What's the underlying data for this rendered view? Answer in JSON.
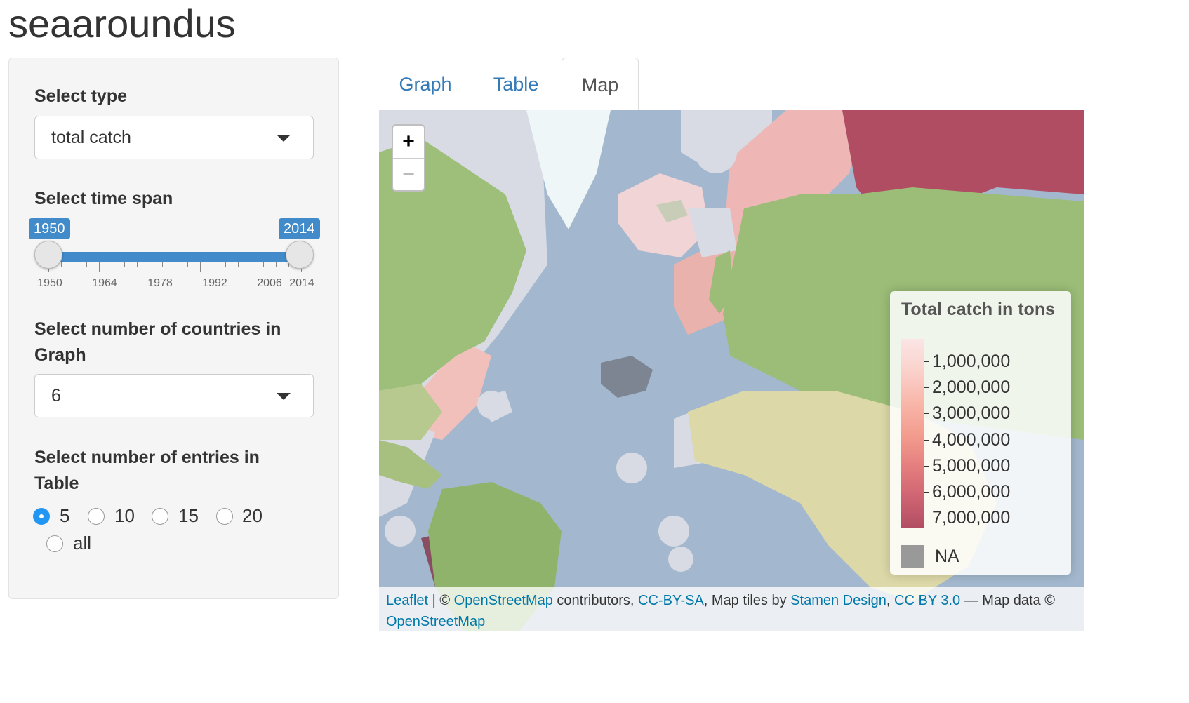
{
  "app": {
    "title": "seaaroundus"
  },
  "sidebar": {
    "type_label": "Select type",
    "type_value": "total catch",
    "timespan_label": "Select time span",
    "timespan": {
      "min": 1950,
      "max": 2014,
      "from_label": "1950",
      "to_label": "2014",
      "from_value": 1950,
      "to_value": 2014,
      "ticks": [
        "1950",
        "1964",
        "1978",
        "1992",
        "2006",
        "2014"
      ]
    },
    "countries_label": "Select number of countries in Graph",
    "countries_label_line1": "Select number of countries in",
    "countries_label_line2": "Graph",
    "countries_value": "6",
    "entries_label_line1": "Select number of entries in",
    "entries_label_line2": "Table",
    "entries_options": [
      "5",
      "10",
      "15",
      "20",
      "all"
    ],
    "entries_selected": "5"
  },
  "tabs": [
    {
      "label": "Graph",
      "active": false
    },
    {
      "label": "Table",
      "active": false
    },
    {
      "label": "Map",
      "active": true
    }
  ],
  "map": {
    "zoom_in": "+",
    "zoom_out": "−",
    "legend": {
      "title": "Total catch in tons",
      "values": [
        "1,000,000",
        "2,000,000",
        "3,000,000",
        "4,000,000",
        "5,000,000",
        "6,000,000",
        "7,000,000"
      ],
      "na_label": "NA",
      "colors": {
        "low": "#fbe5e5",
        "high": "#b14d63",
        "na": "#999999"
      }
    },
    "attribution": {
      "leaflet": "Leaflet",
      "sep1": " | © ",
      "osm": "OpenStreetMap",
      "text1": " contributors, ",
      "ccbysa": "CC-BY-SA",
      "text2": ", Map tiles by ",
      "stamen": "Stamen Design",
      "text3": ", ",
      "ccby": "CC BY 3.0",
      "text4": " — Map data © ",
      "osm2": "OpenStreetMap"
    },
    "colors": {
      "ocean": "#a3b8ce",
      "land": "#cfd8b2",
      "forest": "#8fb36a",
      "ice": "#eef6f8",
      "eez_na": "#d8dbe3",
      "eez_high": "#b14d63",
      "eez_mid": "#e8a09a"
    }
  }
}
